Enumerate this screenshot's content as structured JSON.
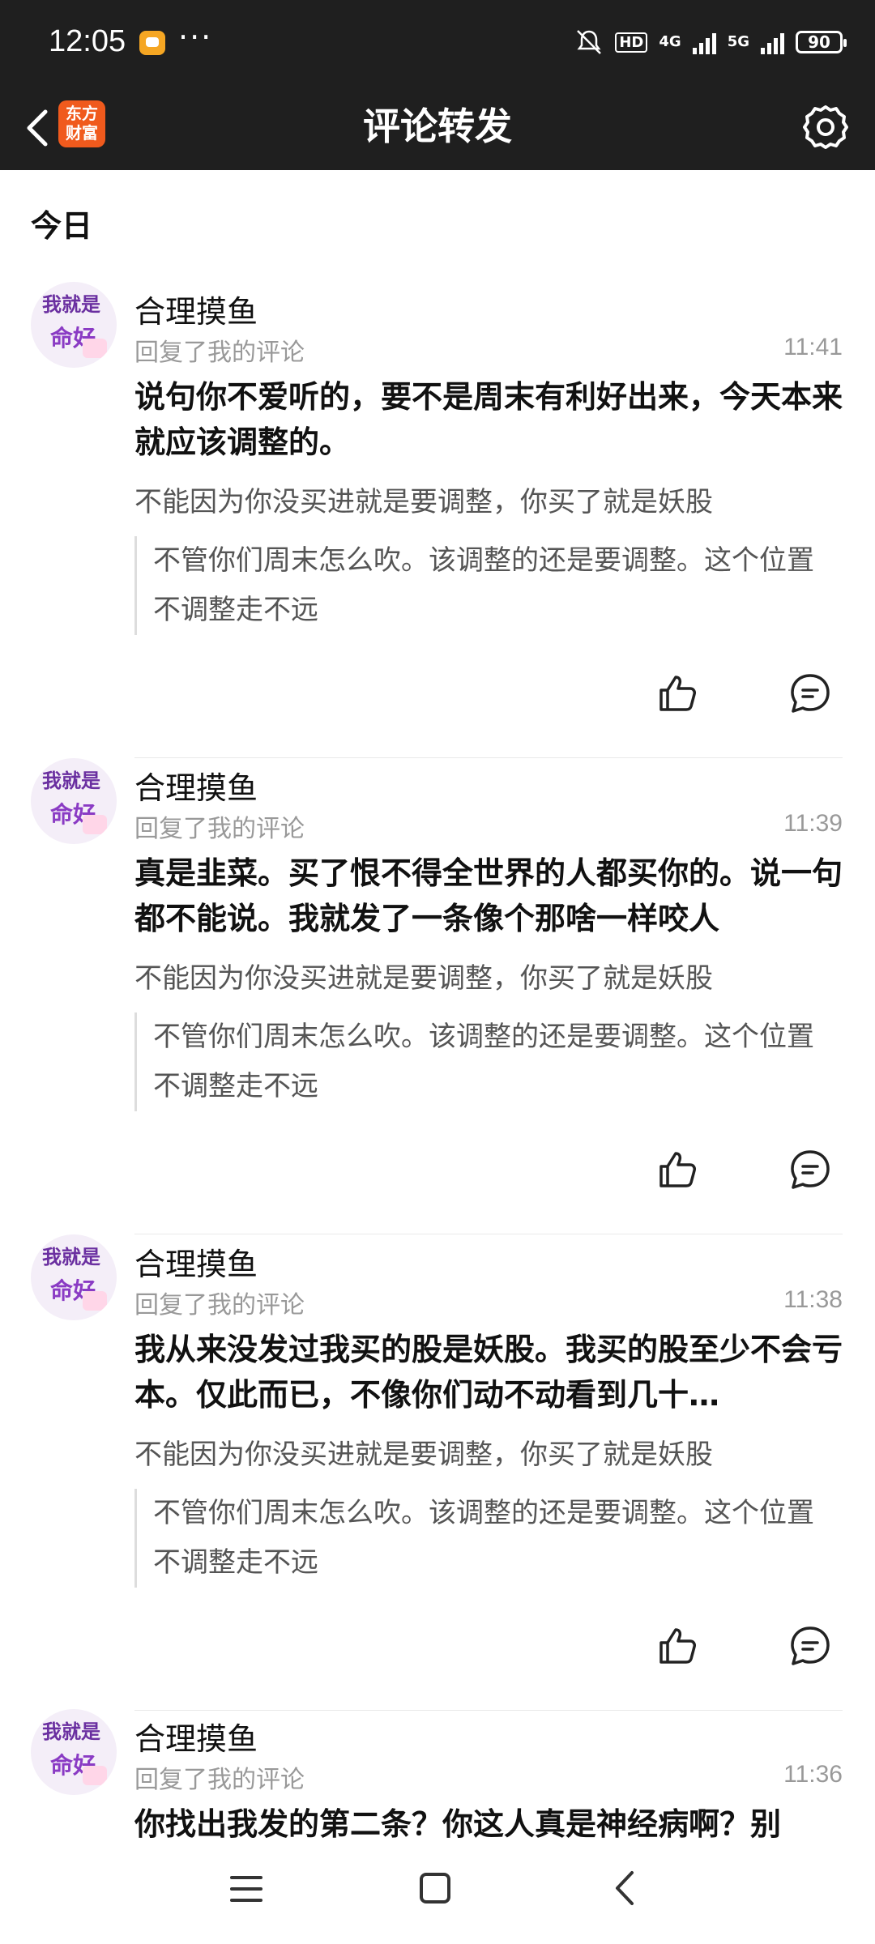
{
  "status_bar": {
    "time": "12:05",
    "dots": "···",
    "hd": "HD",
    "net1": "4G",
    "net2": "5G",
    "battery": "90"
  },
  "header": {
    "logo_line1": "东方",
    "logo_line2": "财富",
    "title": "评论转发"
  },
  "section": {
    "title": "今日"
  },
  "comments": [
    {
      "avatar_line1": "我就是",
      "avatar_line2": "命好",
      "name": "合理摸鱼",
      "reply_label": "回复了我的评论",
      "time": "11:41",
      "text": "说句你不爱听的，要不是周末有利好出来，今天本来就应该调整的。",
      "my_comment": "不能因为你没买进就是要调整，你买了就是妖股",
      "quote": "不管你们周末怎么吹。该调整的还是要调整。这个位置不调整走不远"
    },
    {
      "avatar_line1": "我就是",
      "avatar_line2": "命好",
      "name": "合理摸鱼",
      "reply_label": "回复了我的评论",
      "time": "11:39",
      "text": "真是韭菜。买了恨不得全世界的人都买你的。说一句都不能说。我就发了一条像个那啥一样咬人",
      "my_comment": "不能因为你没买进就是要调整，你买了就是妖股",
      "quote": "不管你们周末怎么吹。该调整的还是要调整。这个位置不调整走不远"
    },
    {
      "avatar_line1": "我就是",
      "avatar_line2": "命好",
      "name": "合理摸鱼",
      "reply_label": "回复了我的评论",
      "time": "11:38",
      "text": "我从来没发过我买的股是妖股。我买的股至少不会亏本。仅此而已，不像你们动不动看到几十…",
      "my_comment": "不能因为你没买进就是要调整，你买了就是妖股",
      "quote": "不管你们周末怎么吹。该调整的还是要调整。这个位置不调整走不远"
    },
    {
      "avatar_line1": "我就是",
      "avatar_line2": "命好",
      "name": "合理摸鱼",
      "reply_label": "回复了我的评论",
      "time": "11:36",
      "text": "你找出我发的第二条？你这人真是神经病啊？别"
    }
  ]
}
